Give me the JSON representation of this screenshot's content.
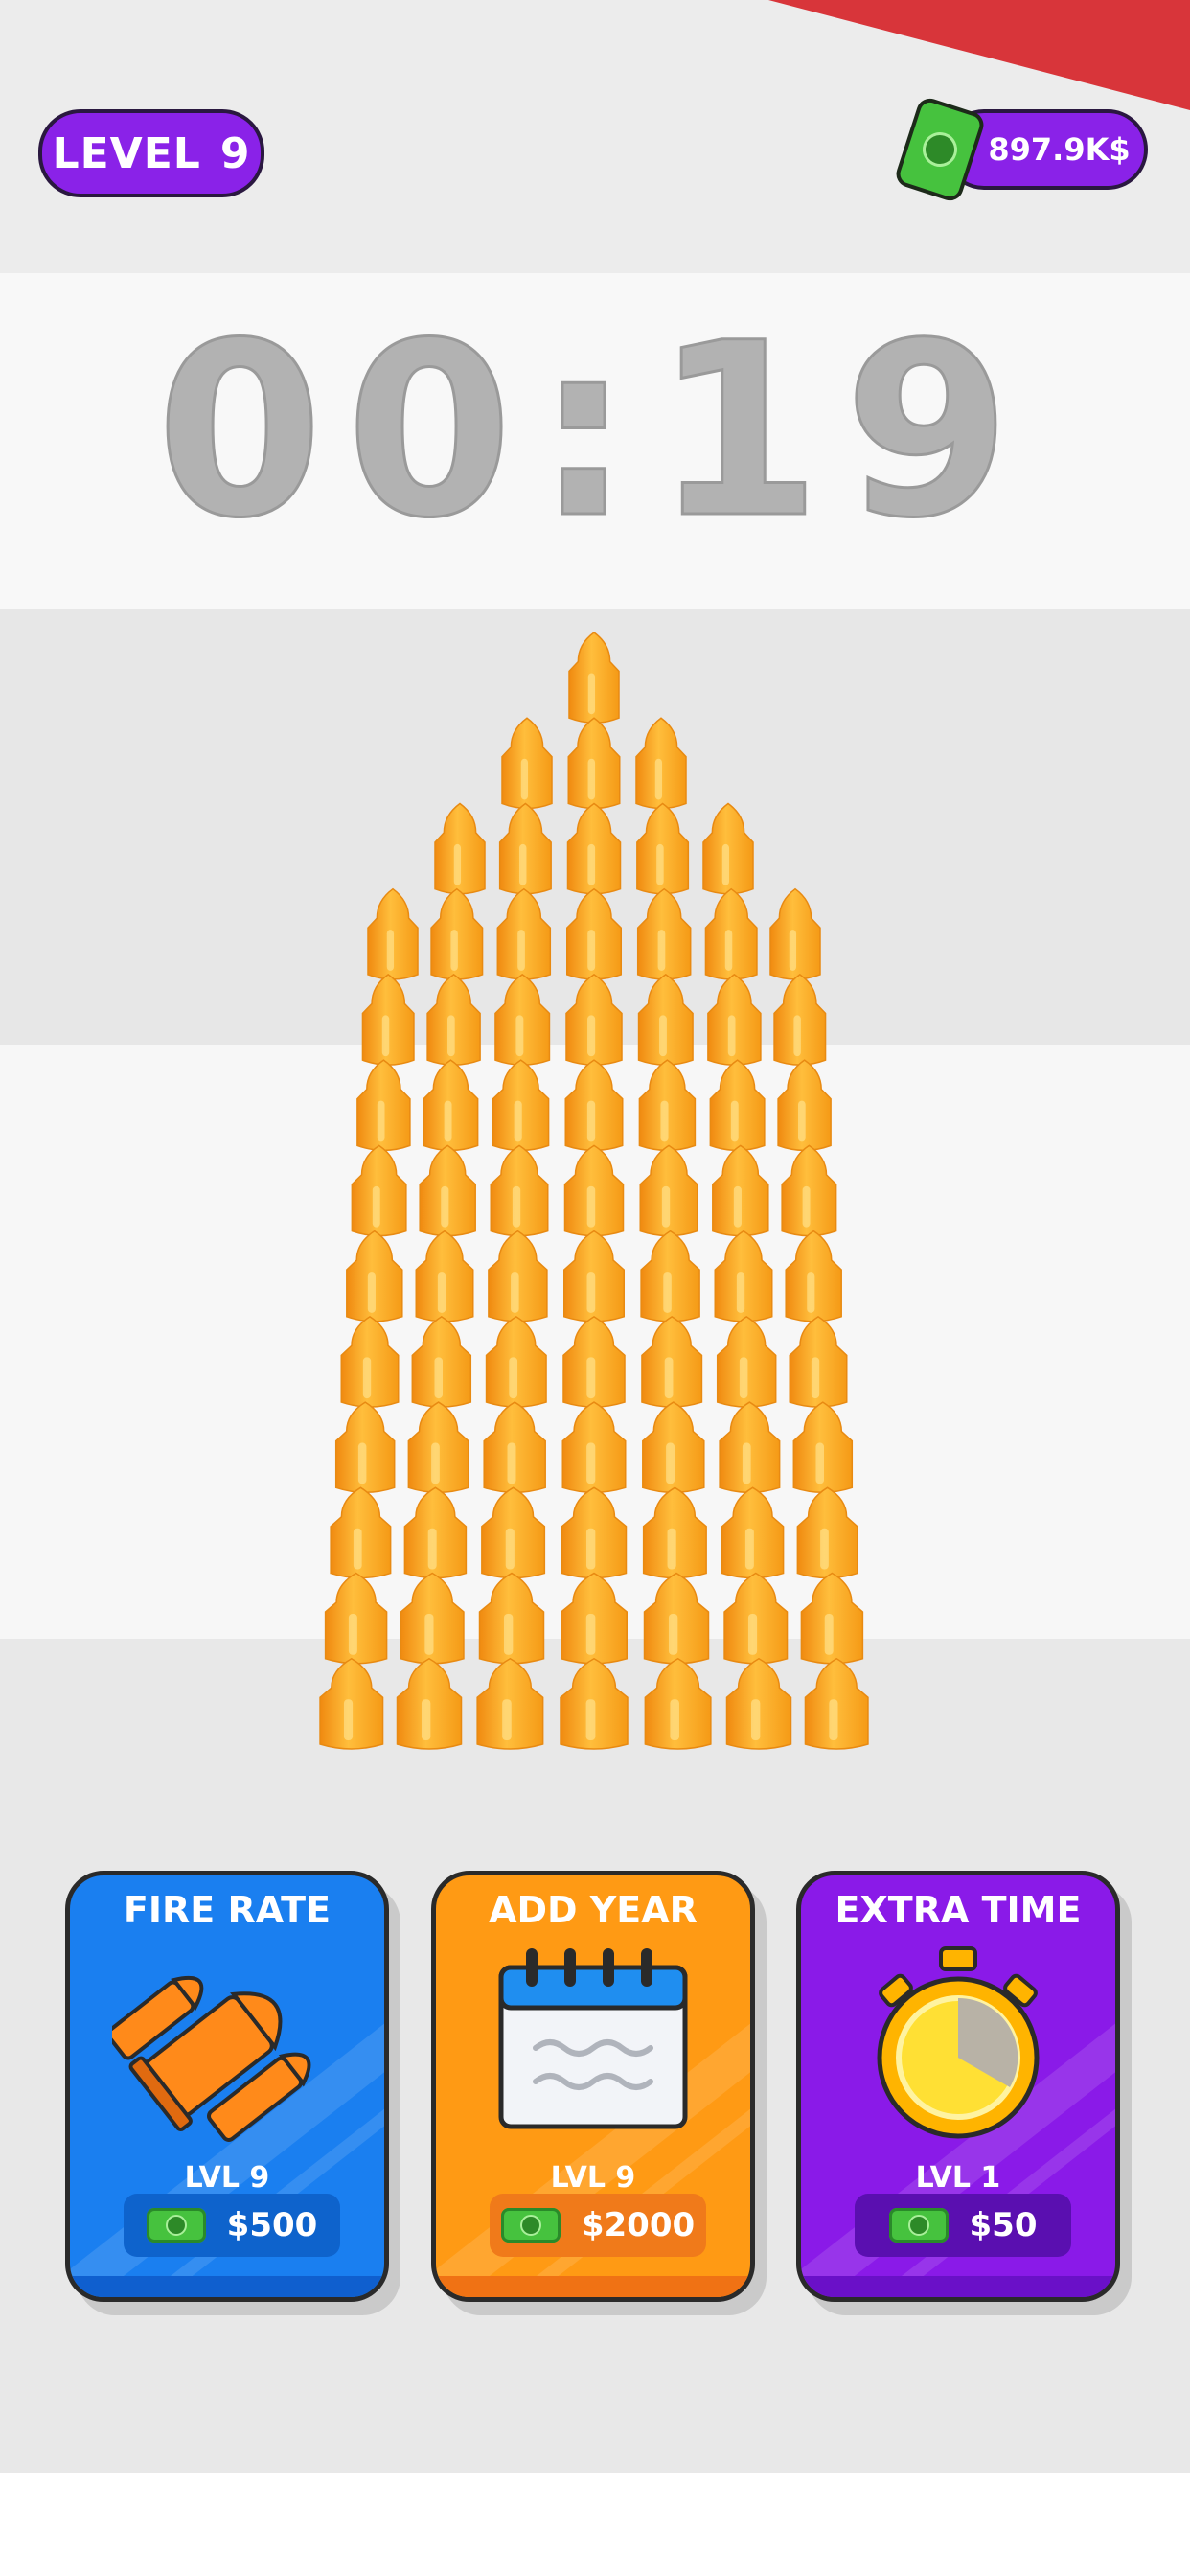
{
  "header": {
    "level_label": "LEVEL",
    "level_number": "9",
    "money": "897.9K$",
    "money_icon": "cash-icon"
  },
  "timer": "00:19",
  "bullet_formation": {
    "columns": 7,
    "bullets_per_column": [
      10,
      11,
      12,
      13,
      12,
      11,
      10
    ]
  },
  "upgrades": [
    {
      "title": "FIRE RATE",
      "level": "LVL 9",
      "price": "$500",
      "icon": "bullets-icon",
      "color": "#1a7ff0"
    },
    {
      "title": "ADD YEAR",
      "level": "LVL 9",
      "price": "$2000",
      "icon": "calendar-icon",
      "color": "#ff9a14"
    },
    {
      "title": "EXTRA TIME",
      "level": "LVL 1",
      "price": "$50",
      "icon": "stopwatch-icon",
      "color": "#8a1ae8"
    }
  ],
  "colors": {
    "accent": "#8a22e8",
    "bullet": "#ffac2a",
    "timer": "#b2b2b2",
    "corner": "#d8353a"
  }
}
